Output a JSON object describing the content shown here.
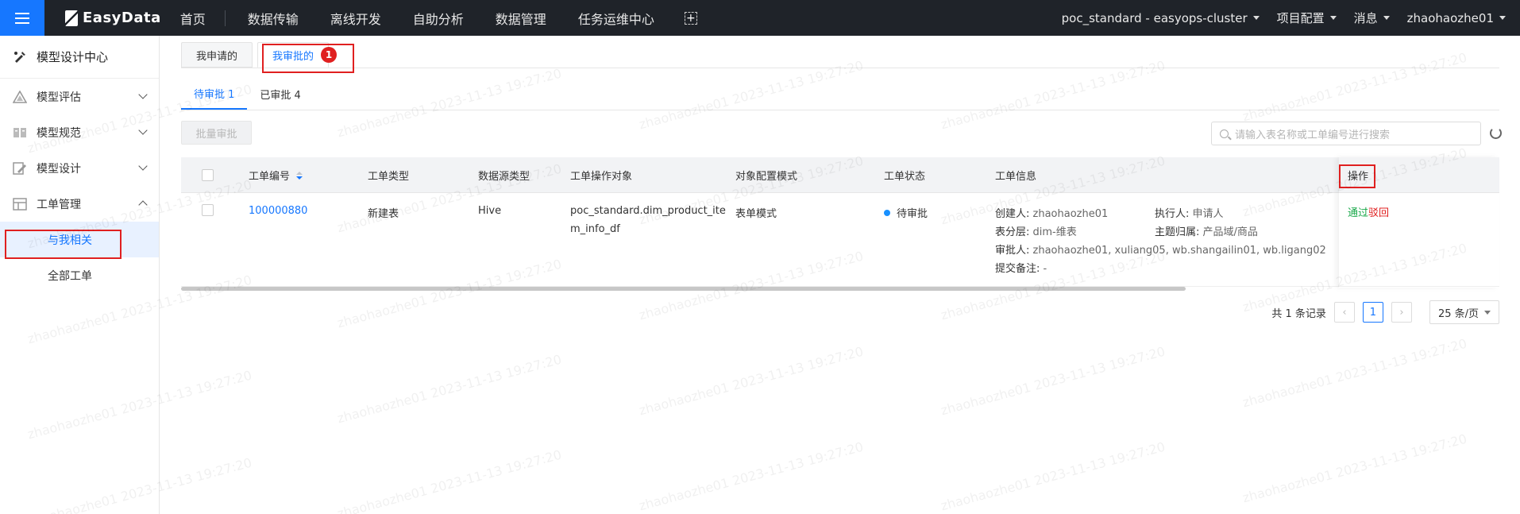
{
  "topbar": {
    "brand": "EasyData",
    "nav": [
      "首页",
      "数据传输",
      "离线开发",
      "自助分析",
      "数据管理",
      "任务运维中心"
    ],
    "project": "poc_standard - easyops-cluster",
    "project_config": "项目配置",
    "messages": "消息",
    "user": "zhaohaozhe01"
  },
  "sidebar": {
    "title": "模型设计中心",
    "items": [
      {
        "label": "模型评估"
      },
      {
        "label": "模型规范"
      },
      {
        "label": "模型设计"
      },
      {
        "label": "工单管理"
      }
    ],
    "sub": [
      {
        "label": "与我相关"
      },
      {
        "label": "全部工单"
      }
    ]
  },
  "tabs": {
    "primary": [
      {
        "label": "我申请的"
      },
      {
        "label": "我审批的"
      }
    ],
    "annotation": "1",
    "secondary": [
      {
        "label": "待审批 1"
      },
      {
        "label": "已审批 4"
      }
    ]
  },
  "toolbar": {
    "batch_label": "批量审批",
    "search_placeholder": "请输入表名称或工单编号进行搜索"
  },
  "table": {
    "columns": [
      "工单编号",
      "工单类型",
      "数据源类型",
      "工单操作对象",
      "对象配置模式",
      "工单状态",
      "工单信息",
      "操作"
    ],
    "row": {
      "id": "100000880",
      "type": "新建表",
      "datasource": "Hive",
      "object_line1": "poc_standard.dim_product_ite",
      "object_line2": "m_info_df",
      "mode": "表单模式",
      "status": "待审批",
      "creator_label": "创建人:",
      "creator": "zhaohaozhe01",
      "executor_label": "执行人:",
      "executor": "申请人",
      "layer_label": "表分层:",
      "layer": "dim-维表",
      "domain_label": "主题归属:",
      "domain": "产品域/商品",
      "approver_label": "审批人:",
      "approver": "zhaohaozhe01, xuliang05, wb.shangailin01, wb.ligang02",
      "remark_label": "提交备注:",
      "remark": "-",
      "action_pass": "通过",
      "action_reject": "驳回"
    }
  },
  "pager": {
    "total": "共 1 条记录",
    "page": "1",
    "size": "25 条/页"
  },
  "watermark": "zhaohaozhe01 2023-11-13 19:27:20",
  "colors": {
    "accent": "#1677ff",
    "topbar": "#1f2329",
    "highlight": "#e02020",
    "pass": "#19a84a"
  }
}
